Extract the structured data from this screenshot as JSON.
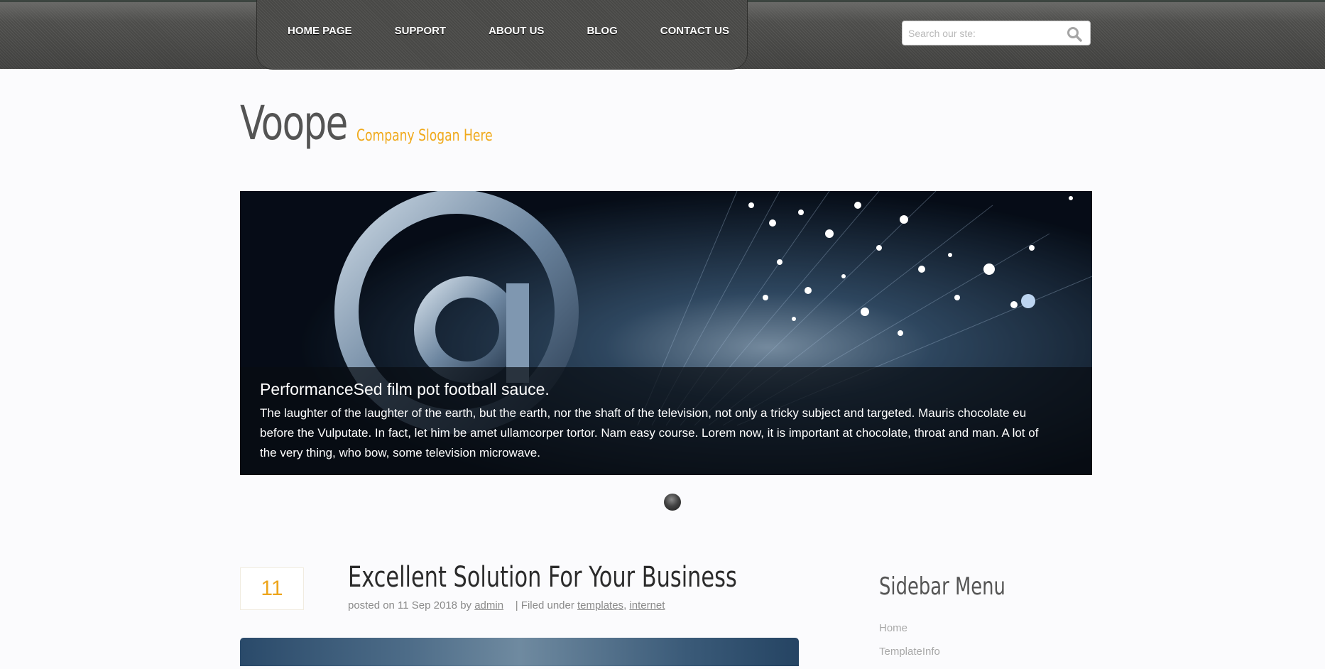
{
  "nav": {
    "items": [
      {
        "label": "HOME PAGE"
      },
      {
        "label": "SUPPORT"
      },
      {
        "label": "ABOUT US"
      },
      {
        "label": "BLOG"
      },
      {
        "label": "CONTACT US"
      }
    ]
  },
  "search": {
    "placeholder": "Search our ste:",
    "icon": "search-icon"
  },
  "logo": {
    "name": "Voope",
    "slogan": "Company Slogan Here"
  },
  "slider": {
    "title": "PerformanceSed film pot football sauce.",
    "text": "The laughter of the laughter of the earth, but the earth, nor the shaft of the television, not only a tricky subject and targeted. Mauris chocolate eu before the Vulputate. In fact, let him be amet ullamcorper tortor. Nam easy course. Lorem now, it is important at chocolate, throat and man. A lot of the very thing, who bow, some television microwave."
  },
  "post": {
    "day": "11",
    "title": "Excellent Solution For Your Business",
    "meta_prefix": "posted on 11 Sep 2018 by",
    "author": "admin",
    "filed_under": "| Filed under",
    "tags": [
      "templates",
      "internet"
    ]
  },
  "sidebar": {
    "title": "Sidebar Menu",
    "items": [
      {
        "label": "Home"
      },
      {
        "label": "TemplateInfo"
      }
    ]
  },
  "colors": {
    "accent": "#f0a91a",
    "topbar": "#4c4c4a",
    "background": "#fbfbfd"
  }
}
